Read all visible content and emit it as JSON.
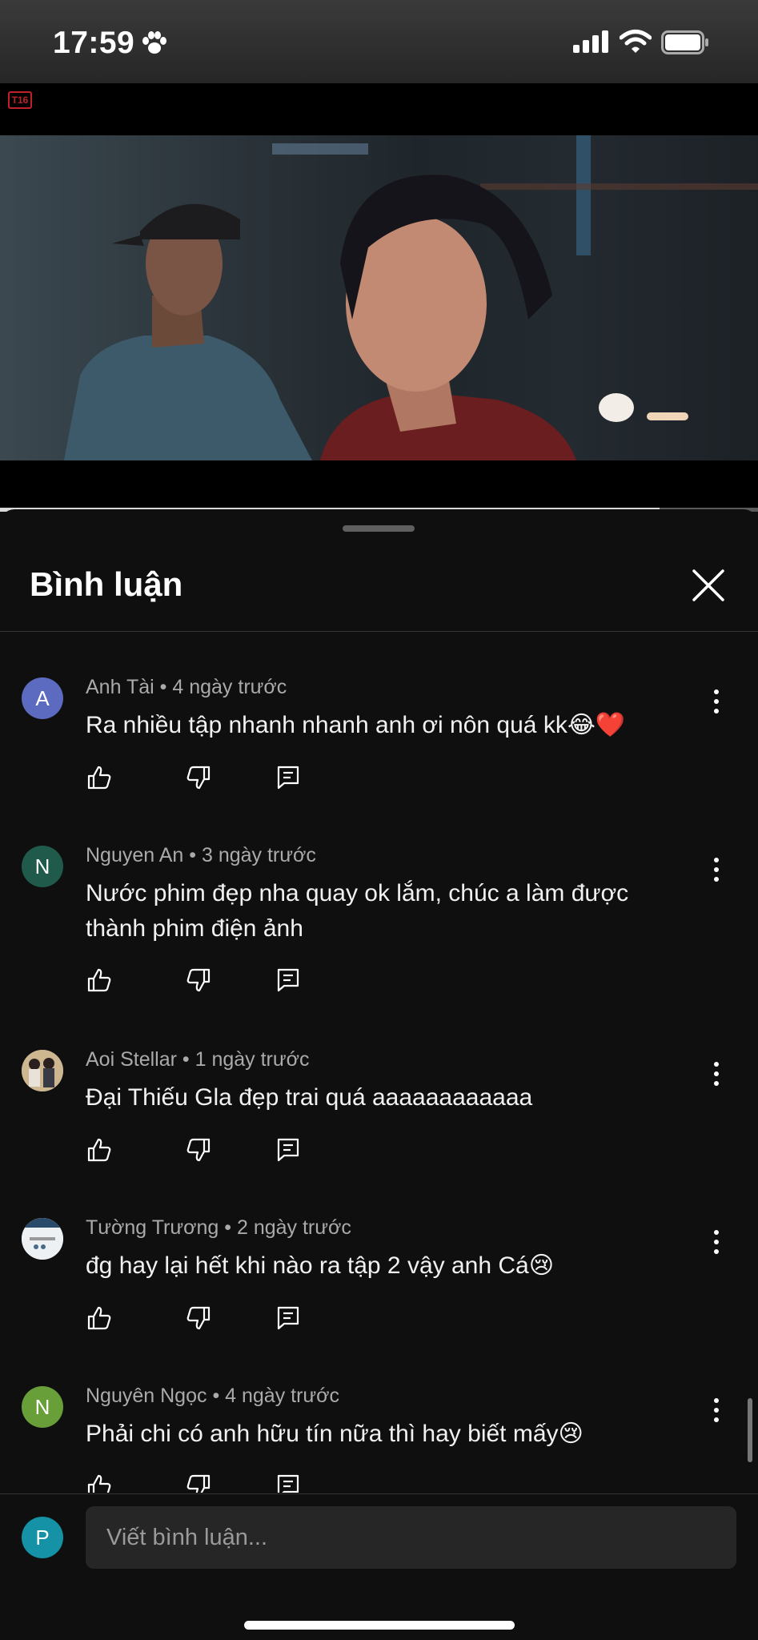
{
  "status_bar": {
    "time": "17:59"
  },
  "video": {
    "rating_badge": "T16",
    "progress_fraction": 0.87
  },
  "comments_panel": {
    "title": "Bình luận",
    "comments": [
      {
        "avatar_letter": "A",
        "avatar_color": "#5c6bc0",
        "author": "Anh Tài",
        "time": "4 ngày trước",
        "text": "Ra nhiều tập nhanh nhanh anh ơi nôn quá kk😂❤️"
      },
      {
        "avatar_letter": "N",
        "avatar_color": "#1f5a4a",
        "author": "Nguyen An",
        "time": "3 ngày trước",
        "text": "Nước phim đẹp nha quay ok lắm, chúc a làm được thành phim điện ảnh"
      },
      {
        "avatar_letter": "",
        "avatar_color": "#b9a27a",
        "author": "Aoi Stellar",
        "time": "1 ngày trước",
        "text": "Đại Thiếu Gla đẹp trai quá aaaaaaaaaaaa"
      },
      {
        "avatar_letter": "",
        "avatar_color": "#e8ecf0",
        "author": "Tường Trương",
        "time": "2 ngày trước",
        "text": "đg hay lại hết khi nào ra tập 2 vậy anh Cá😢"
      },
      {
        "avatar_letter": "N",
        "avatar_color": "#689f38",
        "author": "Nguyên Ngọc",
        "time": "4 ngày trước",
        "text": "Phải chi có anh hữu tín nữa thì hay biết mấy😢"
      }
    ]
  },
  "input": {
    "user_letter": "P",
    "placeholder": "Viết bình luận..."
  }
}
